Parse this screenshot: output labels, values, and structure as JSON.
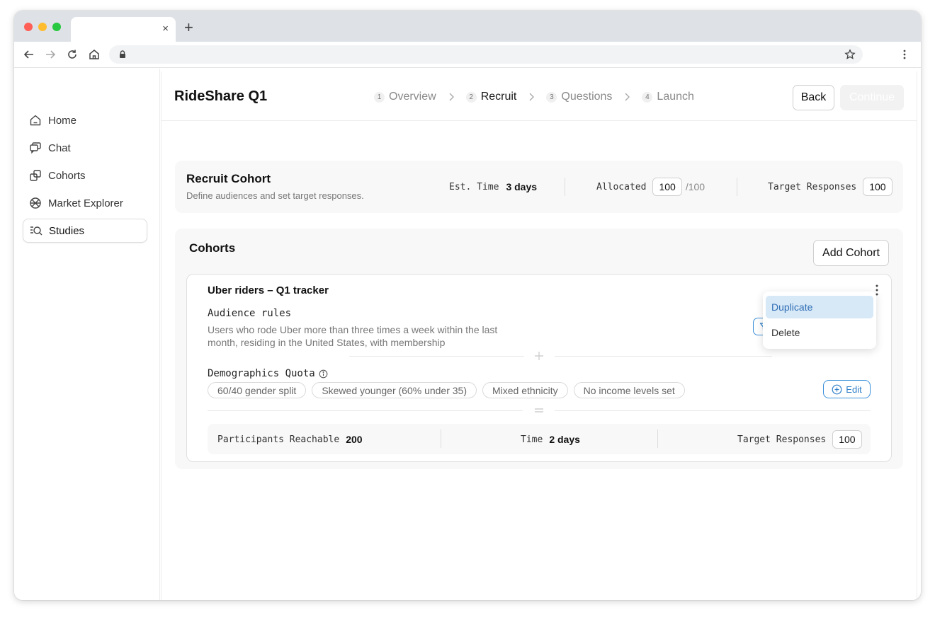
{
  "browser": {
    "tab_close": "×",
    "new_tab": "+"
  },
  "sidebar": {
    "items": [
      {
        "label": "Home",
        "icon": "home-icon"
      },
      {
        "label": "Chat",
        "icon": "chat-icon"
      },
      {
        "label": "Cohorts",
        "icon": "cohorts-icon"
      },
      {
        "label": "Market Explorer",
        "icon": "globe-icon"
      },
      {
        "label": "Studies",
        "icon": "studies-icon",
        "active": true
      }
    ]
  },
  "header": {
    "title": "RideShare Q1",
    "steps": [
      {
        "num": "1",
        "label": "Overview"
      },
      {
        "num": "2",
        "label": "Recruit",
        "current": true
      },
      {
        "num": "3",
        "label": "Questions"
      },
      {
        "num": "4",
        "label": "Launch"
      }
    ],
    "back_label": "Back",
    "continue_label": "Continue"
  },
  "summary": {
    "title": "Recruit Cohort",
    "subtitle": "Define audiences and set target responses.",
    "est_time_label": "Est. Time",
    "est_time_value": "3 days",
    "allocated_label": "Allocated",
    "allocated_value": "100",
    "allocated_total": "/100",
    "target_label": "Target Responses",
    "target_value": "100"
  },
  "cohorts": {
    "title": "Cohorts",
    "add_label": "Add Cohort",
    "card": {
      "title": "Uber riders – Q1 tracker",
      "rules_label": "Audience rules",
      "rules_text": "Users who rode Uber more than three times a week within the last month, residing in the United States, with membership",
      "filter_label": "R",
      "demo_label": "Demographics Quota",
      "pills": [
        "60/40 gender split",
        "Skewed younger (60% under 35)",
        "Mixed ethnicity",
        "No income levels set"
      ],
      "edit_label": "Edit",
      "reachable_label": "Participants Reachable",
      "reachable_value": "200",
      "time_label": "Time",
      "time_value": "2 days",
      "target_label": "Target Responses",
      "target_value": "100"
    }
  },
  "menu": {
    "items": [
      "Duplicate",
      "Delete"
    ]
  },
  "colors": {
    "accent": "#2f7fc8",
    "highlight": "#d7e8f7"
  }
}
